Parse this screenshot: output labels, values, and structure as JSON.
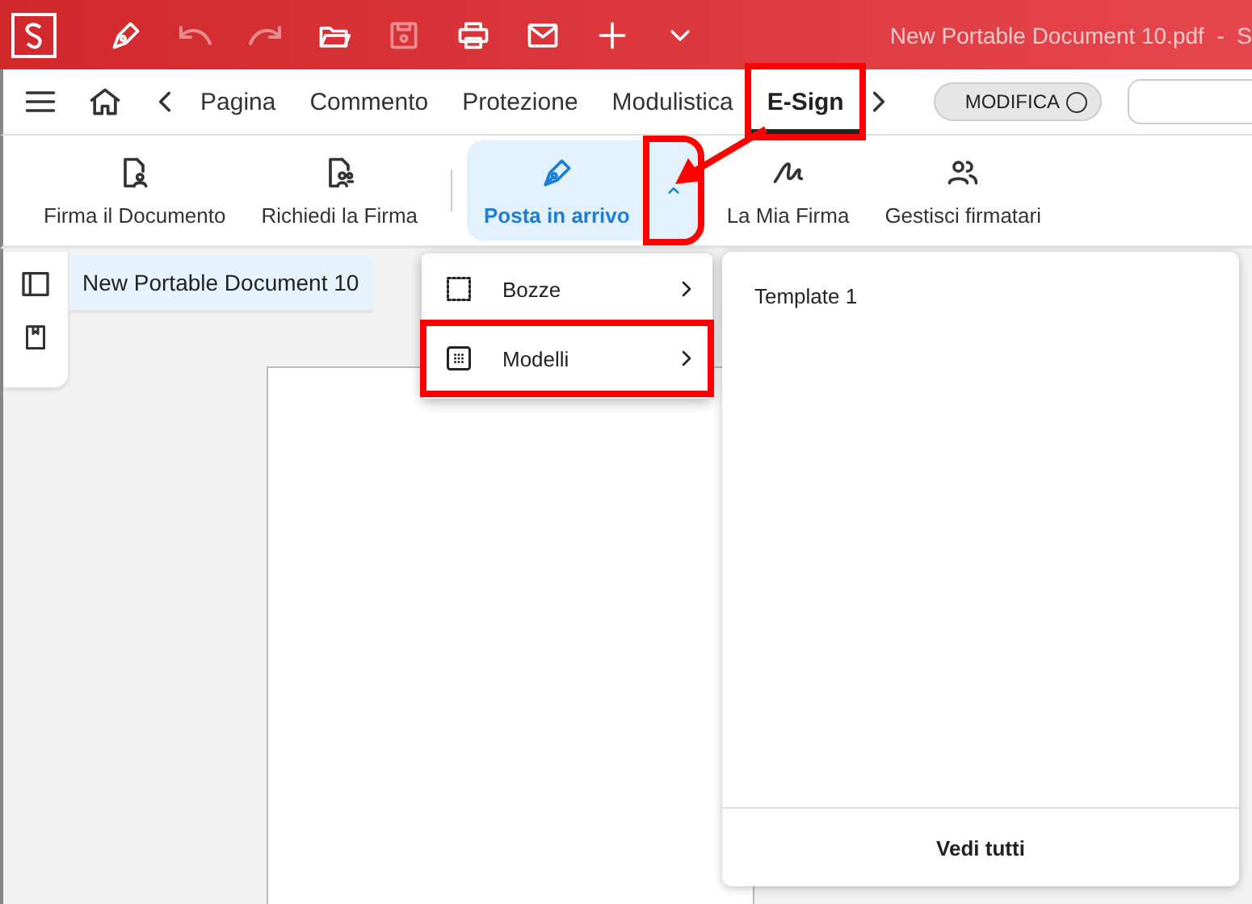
{
  "window": {
    "title": "New Portable Document 10.pdf  -  S"
  },
  "nav_tabs": [
    {
      "label": "Pagina",
      "selected": false,
      "highlighted": false
    },
    {
      "label": "Commento",
      "selected": false,
      "highlighted": false
    },
    {
      "label": "Protezione",
      "selected": false,
      "highlighted": false
    },
    {
      "label": "Modulistica",
      "selected": false,
      "highlighted": false
    },
    {
      "label": "E-Sign",
      "selected": true,
      "highlighted": true
    }
  ],
  "mode_toggle": {
    "label": "MODIFICA",
    "on": false
  },
  "ribbon": [
    {
      "kind": "doc-sign",
      "label": "Firma il Documento",
      "selected": false
    },
    {
      "kind": "doc-request",
      "label": "Richiedi la Firma",
      "selected": false
    },
    {
      "kind": "pen",
      "label": "Posta in arrivo",
      "selected": true,
      "dropdown": {
        "expanded": true,
        "highlighted": true
      }
    },
    {
      "kind": "signature",
      "label": "La Mia Firma",
      "selected": false
    },
    {
      "kind": "people",
      "label": "Gestisci firmatari",
      "selected": false
    }
  ],
  "document_tab": {
    "title": "New Portable Document 10"
  },
  "menu": [
    {
      "kind": "dashed",
      "label": "Bozze",
      "highlighted": false
    },
    {
      "kind": "dotted",
      "label": "Modelli",
      "highlighted": true
    }
  ],
  "panel": {
    "items": [
      "Template 1"
    ],
    "footer": "Vedi tutti"
  }
}
